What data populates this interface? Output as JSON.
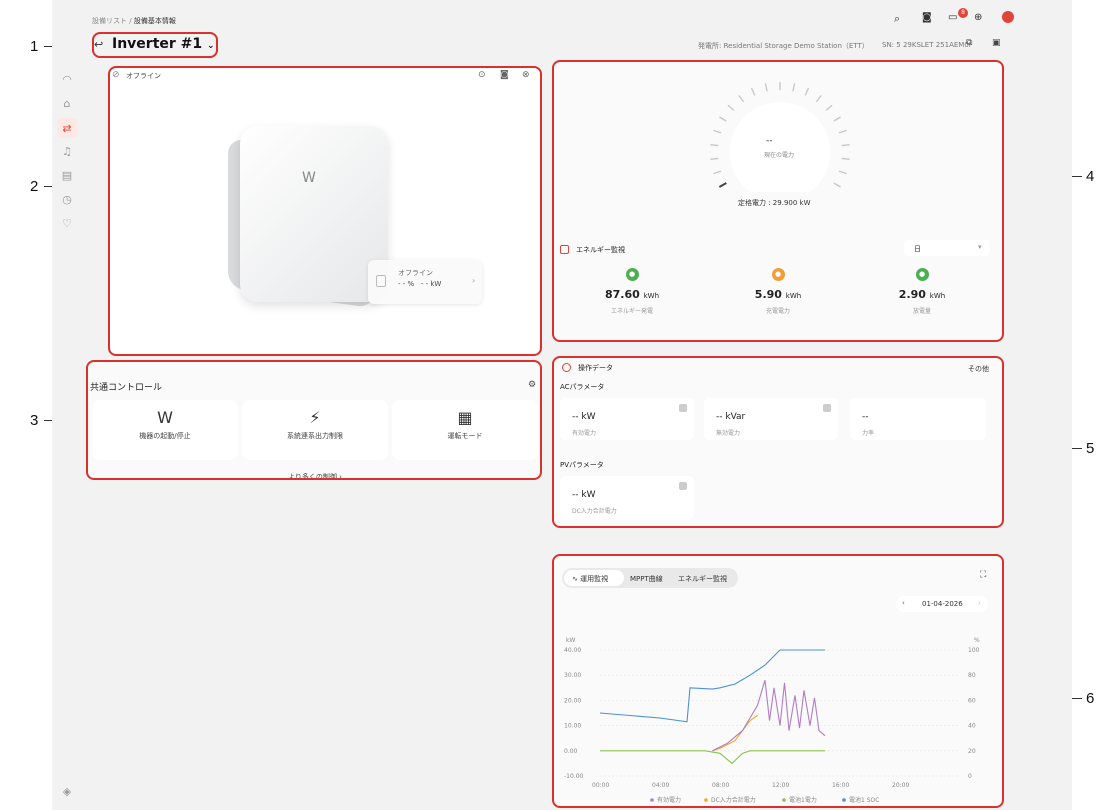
{
  "header": {
    "breadcrumb_parent": "設備リスト",
    "breadcrumb_sep": "/",
    "breadcrumb_current": "設備基本情報",
    "device_title": "Inverter #1",
    "station_label": "発電所: Residential Storage Demo Station（ETT）",
    "sn_label": "SN: 5 29KSLET 251AEM0I",
    "notification_count": "8"
  },
  "callouts": [
    "1",
    "2",
    "3",
    "4",
    "5",
    "6"
  ],
  "device_panel": {
    "status": "オフライン",
    "popup_status": "オフライン",
    "popup_values": "- - %   - - kW"
  },
  "gauge": {
    "value": "--",
    "label": "現在の電力",
    "rated": "定格電力 : 29.900 kW"
  },
  "energy": {
    "title": "エネルギー監視",
    "period": "日",
    "items": [
      {
        "value": "87.60",
        "unit": "kWh",
        "label": "エネルギー発電",
        "color": "#4caf50"
      },
      {
        "value": "5.90",
        "unit": "kWh",
        "label": "充電電力",
        "color": "#f39c3a"
      },
      {
        "value": "2.90",
        "unit": "kWh",
        "label": "放電量",
        "color": "#4caf50"
      }
    ]
  },
  "common_control": {
    "title": "共通コントロール",
    "buttons": [
      {
        "label": "機器の起動/停止",
        "icon": "W"
      },
      {
        "label": "系統連系出力制限",
        "icon": "⚡"
      },
      {
        "label": "運転モード",
        "icon": "▦"
      }
    ],
    "more": "より多くの制御 ›"
  },
  "operation": {
    "title": "操作データ",
    "more": "その他",
    "ac_title": "ACパラメータ",
    "ac_params": [
      {
        "value": "-- kW",
        "name": "有効電力"
      },
      {
        "value": "-- kVar",
        "name": "無効電力"
      },
      {
        "value": "--",
        "name": "力率"
      }
    ],
    "pv_title": "PVパラメータ",
    "pv_params": [
      {
        "value": "-- kW",
        "name": "DC入力合計電力"
      }
    ]
  },
  "chart_panel": {
    "tabs": [
      "運用監視",
      "MPPT曲線",
      "エネルギー監視"
    ],
    "date": "01-04-2026"
  },
  "chart_data": {
    "type": "line",
    "ylabel_left": "kW",
    "ylabel_right": "%",
    "ylim_left": [
      -10,
      40
    ],
    "ylim_right": [
      0,
      100
    ],
    "y_ticks_left": [
      "40.00",
      "30.00",
      "20.00",
      "10.00",
      "0.00",
      "-10.00"
    ],
    "y_ticks_right": [
      "100",
      "80",
      "60",
      "40",
      "20",
      "0"
    ],
    "x_ticks": [
      "00:00",
      "04:00",
      "08:00",
      "12:00",
      "16:00",
      "20:00"
    ],
    "legend": [
      "有効電力",
      "DC入力合計電力",
      "電池1電力",
      "電池1 SOC"
    ],
    "series": [
      {
        "name": "電池1 SOC",
        "axis": "right",
        "color": "#4a90d9",
        "x": [
          0,
          2,
          4,
          5.8,
          6.0,
          7.5,
          8,
          9,
          10,
          11,
          12,
          15
        ],
        "y": [
          50,
          48,
          46,
          43,
          70,
          69,
          70,
          73,
          80,
          88,
          100,
          100
        ]
      },
      {
        "name": "電池1電力",
        "axis": "left",
        "color": "#8bc34a",
        "x": [
          0,
          4,
          7,
          8,
          8.8,
          9.5,
          10,
          12,
          15
        ],
        "y": [
          0,
          0,
          0,
          -1,
          -5,
          -1,
          0,
          0,
          0
        ]
      },
      {
        "name": "DC入力合計電力",
        "axis": "left",
        "color": "#f5a623",
        "x": [
          7.5,
          8,
          9,
          9.5,
          10,
          10.5
        ],
        "y": [
          0,
          1,
          4,
          8,
          12,
          14
        ]
      },
      {
        "name": "有効電力",
        "axis": "left",
        "color": "#b07cc6",
        "x": [
          7.5,
          8.5,
          9.5,
          10,
          10.5,
          11,
          11.3,
          11.6,
          12,
          12.3,
          12.6,
          13,
          13.3,
          13.6,
          14,
          14.3,
          14.6,
          15
        ],
        "y": [
          0,
          3,
          8,
          13,
          18,
          28,
          12,
          25,
          10,
          27,
          8,
          22,
          9,
          24,
          10,
          21,
          8,
          6
        ]
      }
    ]
  }
}
